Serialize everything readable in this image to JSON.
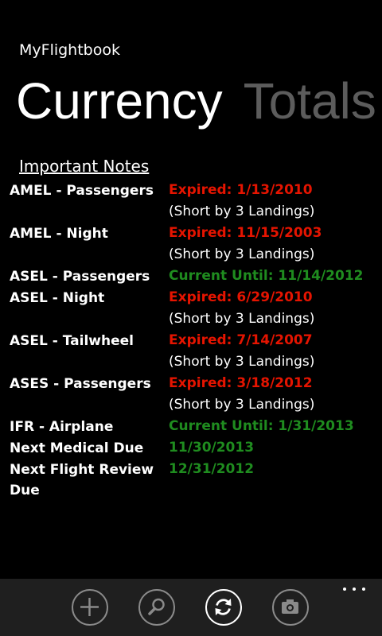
{
  "app": {
    "title": "MyFlightbook"
  },
  "pivot": {
    "active": "Currency",
    "next": "Totals"
  },
  "notes_link": "Important Notes",
  "currency": [
    {
      "label": "AMEL - Passengers",
      "value": "Expired: 1/13/2010",
      "status": "expired",
      "detail": "(Short by 3 Landings)"
    },
    {
      "label": "AMEL - Night",
      "value": "Expired: 11/15/2003",
      "status": "expired",
      "detail": "(Short by 3 Landings)"
    },
    {
      "label": "ASEL - Passengers",
      "value": "Current Until: 11/14/2012",
      "status": "current",
      "detail": ""
    },
    {
      "label": "ASEL - Night",
      "value": "Expired: 6/29/2010",
      "status": "expired",
      "detail": "(Short by 3 Landings)"
    },
    {
      "label": "ASEL - Tailwheel",
      "value": "Expired: 7/14/2007",
      "status": "expired",
      "detail": "(Short by 3 Landings)"
    },
    {
      "label": "ASES - Passengers",
      "value": "Expired: 3/18/2012",
      "status": "expired",
      "detail": "(Short by 3 Landings)"
    },
    {
      "label": "IFR - Airplane",
      "value": "Current Until: 1/31/2013",
      "status": "current",
      "detail": ""
    },
    {
      "label": "Next Medical Due",
      "value": "11/30/2013",
      "status": "current",
      "detail": ""
    },
    {
      "label": "Next Flight Review Due",
      "value": "12/31/2012",
      "status": "current",
      "detail": ""
    }
  ],
  "app_bar": {
    "buttons": [
      {
        "icon": "add-icon"
      },
      {
        "icon": "search-icon"
      },
      {
        "icon": "refresh-icon"
      },
      {
        "icon": "camera-icon"
      }
    ],
    "more": "more-icon"
  },
  "colors": {
    "background": "#000000",
    "expired": "#e51400",
    "current": "#1f8c1f",
    "inactive_pivot": "#5c5c5c",
    "app_bar": "#1f1f1f"
  }
}
